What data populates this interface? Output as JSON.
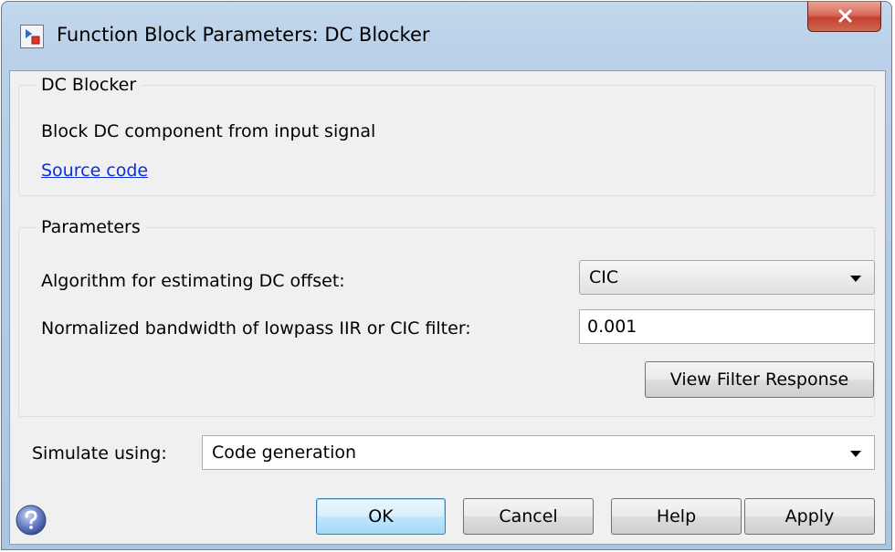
{
  "window": {
    "title": "Function Block Parameters: DC Blocker",
    "icons": {
      "app": "simulink-block-icon",
      "close": "close-icon"
    }
  },
  "description_group": {
    "caption": "DC Blocker",
    "text": "Block DC component from input signal",
    "link": "Source code"
  },
  "parameters_group": {
    "caption": "Parameters",
    "algorithm_label": "Algorithm for estimating DC offset:",
    "algorithm_value": "CIC",
    "bandwidth_label": "Normalized bandwidth of lowpass IIR or CIC filter:",
    "bandwidth_value": "0.001",
    "view_filter_button": "View Filter Response"
  },
  "simulate": {
    "label": "Simulate using:",
    "value": "Code generation"
  },
  "footer": {
    "help_icon": "help-icon",
    "ok": "OK",
    "cancel": "Cancel",
    "help": "Help",
    "apply": "Apply"
  },
  "colors": {
    "title_bar": "#b9d0e8",
    "client_bg": "#f0f0f0",
    "close_button": "#c5402f",
    "link": "#0b30d8",
    "default_button": "#bee6fd"
  }
}
